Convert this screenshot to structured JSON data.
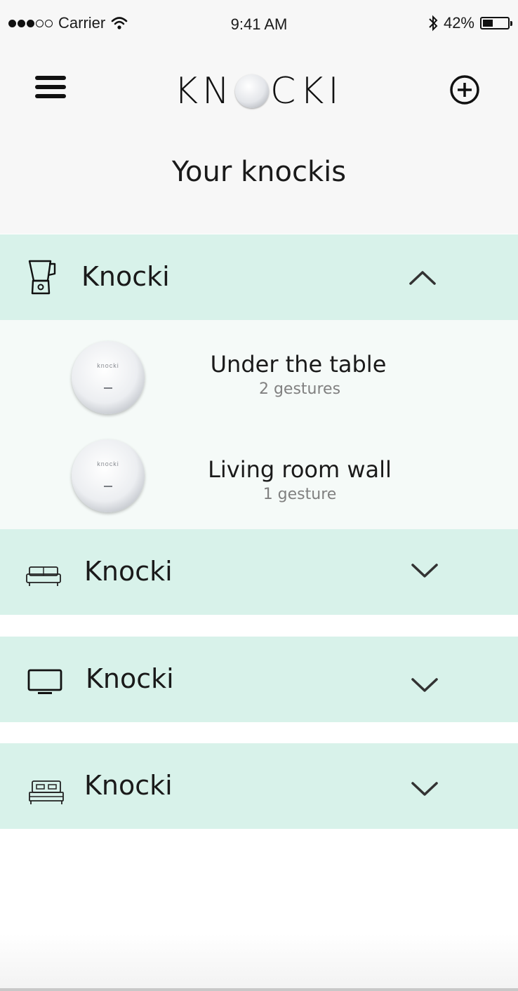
{
  "status_bar": {
    "carrier": "Carrier",
    "time": "9:41 AM",
    "battery_percent": "42%",
    "battery_level": 0.42,
    "signal_bars_filled": 3,
    "signal_bars_total": 5
  },
  "header": {
    "logo_text_left": "KN",
    "logo_text_right": "CKI",
    "title": "Your knockis"
  },
  "groups": [
    {
      "label": "Knocki",
      "icon": "blender-icon",
      "expanded": true,
      "devices": [
        {
          "name": "Under the table",
          "gestures": "2 gestures",
          "brand": "knocki"
        },
        {
          "name": "Living room wall",
          "gestures": "1 gesture",
          "brand": "knocki"
        }
      ]
    },
    {
      "label": "Knocki",
      "icon": "sofa-icon",
      "expanded": false
    },
    {
      "label": "Knocki",
      "icon": "tv-icon",
      "expanded": false
    },
    {
      "label": "Knocki",
      "icon": "bed-icon",
      "expanded": false
    }
  ],
  "colors": {
    "group_background": "#d8f2ea",
    "expanded_background": "#f5faf8",
    "header_background": "#f7f7f7",
    "secondary_text": "#808080"
  }
}
